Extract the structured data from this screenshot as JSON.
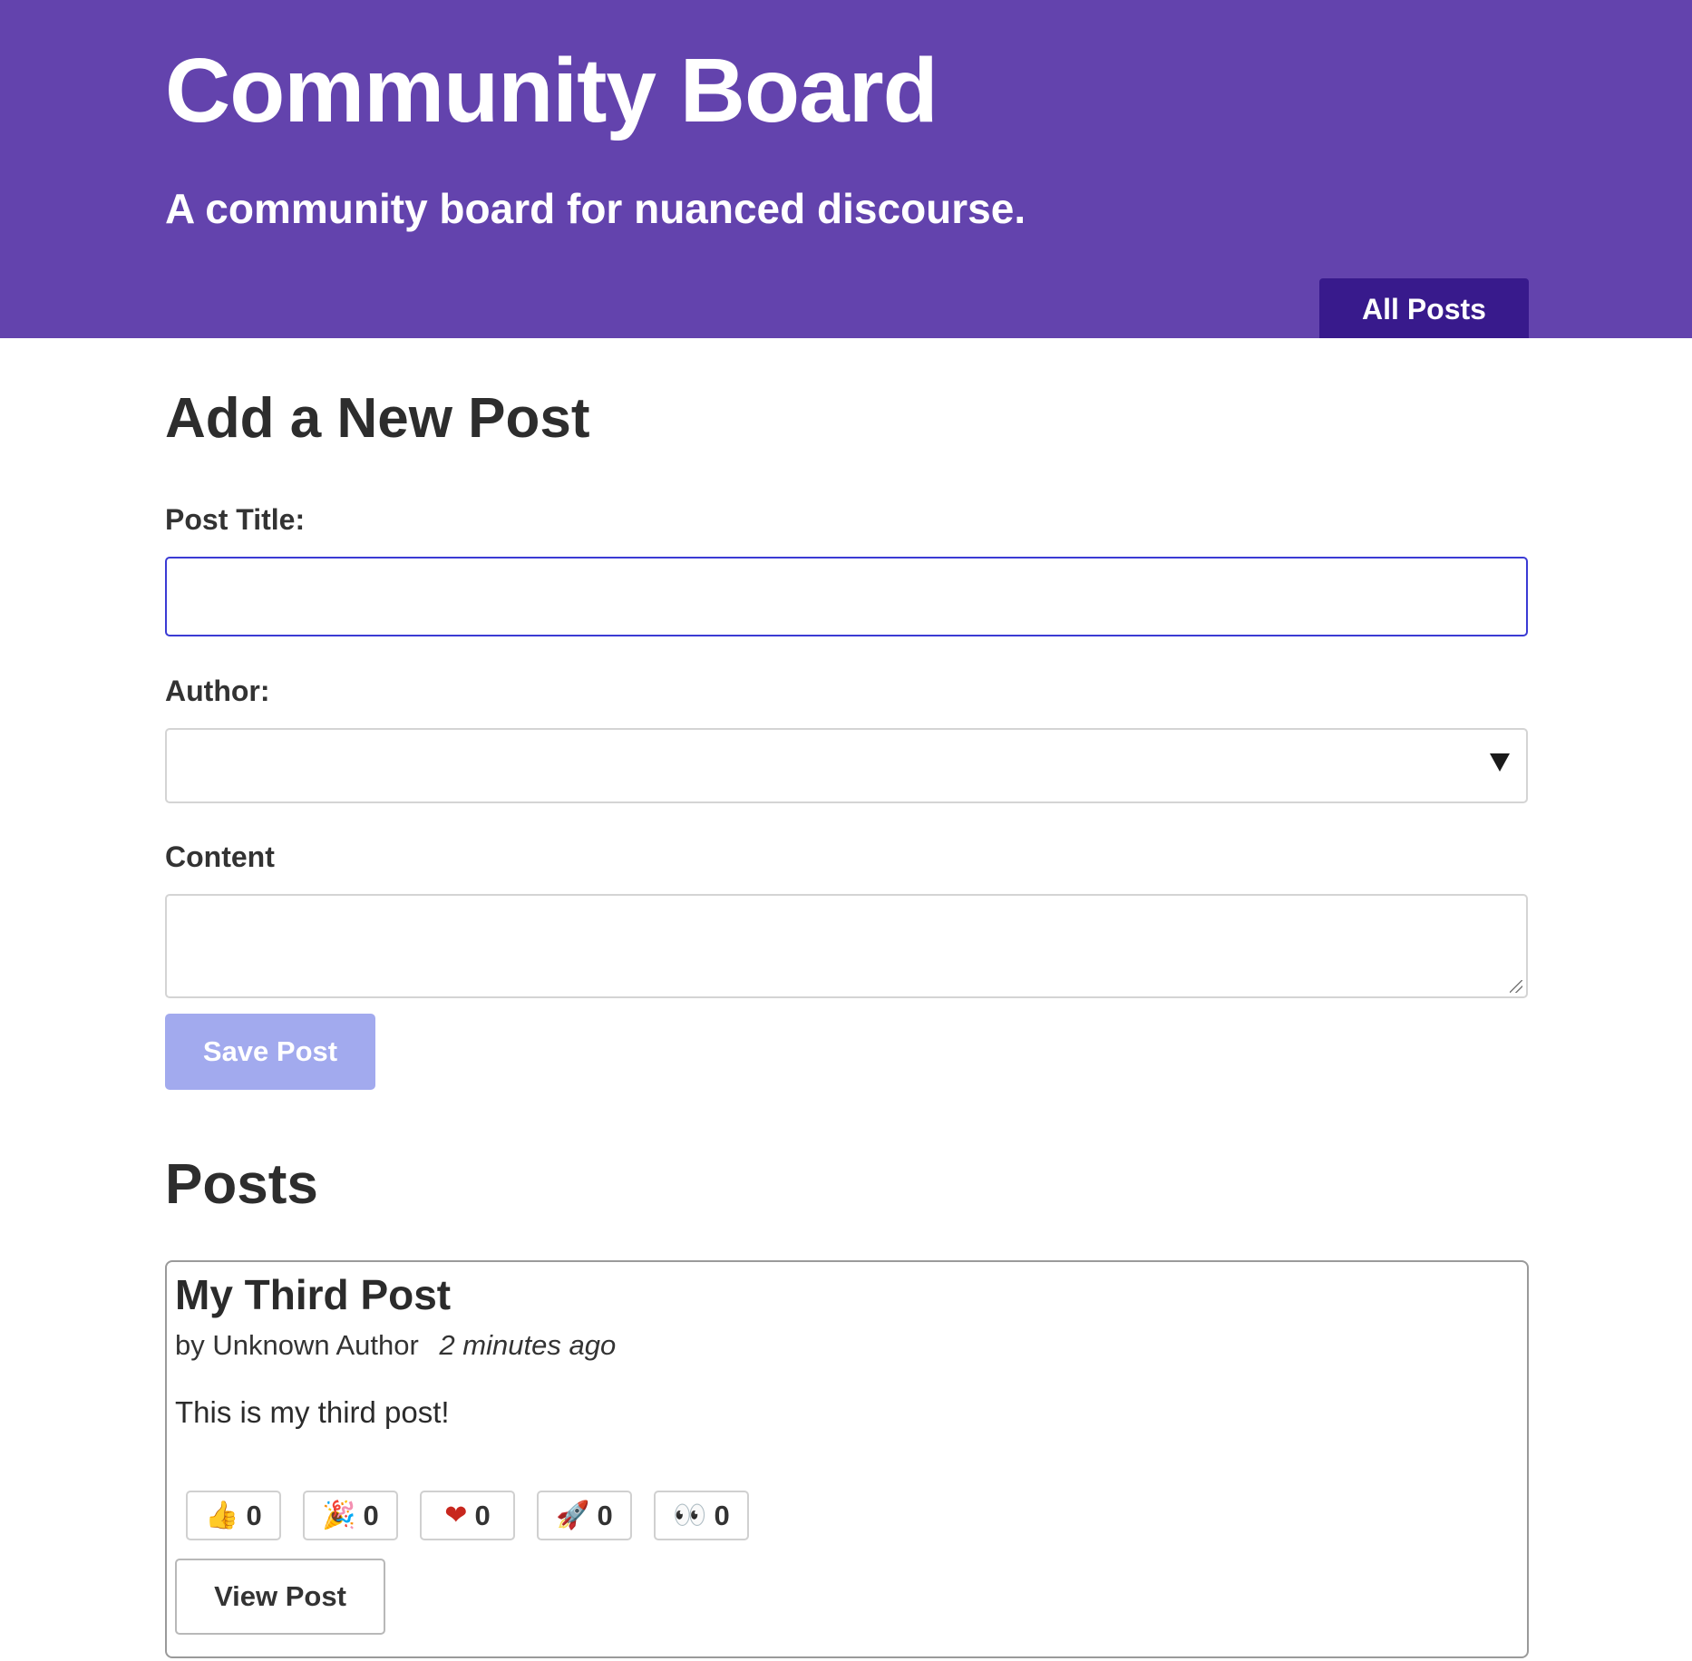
{
  "header": {
    "title": "Community Board",
    "subtitle": "A community board for nuanced discourse.",
    "nav_button": "All Posts",
    "background_color": "#6343ad",
    "nav_button_color": "#381a8c"
  },
  "add_post": {
    "heading": "Add a New Post",
    "title_label": "Post Title:",
    "title_value": "",
    "author_label": "Author:",
    "author_selected": "",
    "content_label": "Content",
    "content_value": "",
    "save_button": "Save Post",
    "save_button_color": "#a2aaee",
    "save_button_disabled": true
  },
  "posts_section": {
    "heading": "Posts",
    "posts": [
      {
        "title": "My Third Post",
        "author": "by Unknown Author",
        "time": "2 minutes ago",
        "content": "This is my third post!",
        "reactions": [
          {
            "icon": "thumbs-up-icon",
            "emoji": "👍",
            "count": "0"
          },
          {
            "icon": "party-popper-icon",
            "emoji": "🎉",
            "count": "0"
          },
          {
            "icon": "heart-icon",
            "emoji": "❤",
            "count": "0"
          },
          {
            "icon": "rocket-icon",
            "emoji": "🚀",
            "count": "0"
          },
          {
            "icon": "eyes-icon",
            "emoji": "👀",
            "count": "0"
          }
        ],
        "view_button": "View Post"
      }
    ]
  }
}
